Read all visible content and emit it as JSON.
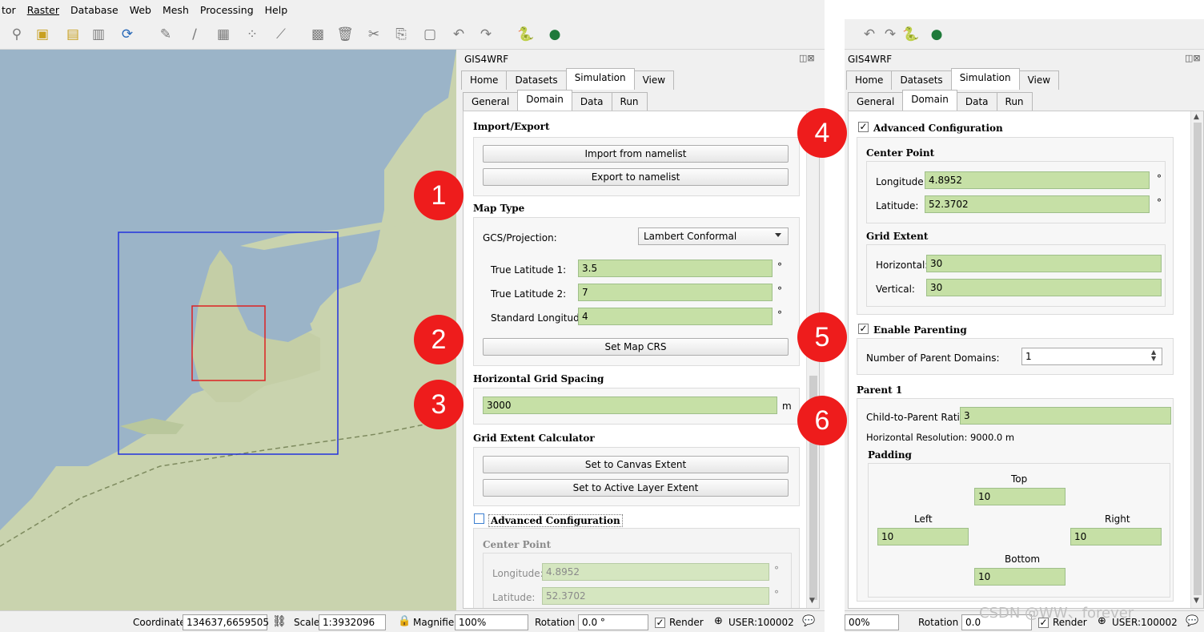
{
  "menu": [
    "tor",
    "Raster",
    "Database",
    "Web",
    "Mesh",
    "Processing",
    "Help"
  ],
  "panel_title": "GIS4WRF",
  "main_tabs": [
    "Home",
    "Datasets",
    "Simulation",
    "View"
  ],
  "sub_tabs": [
    "General",
    "Domain",
    "Data",
    "Run"
  ],
  "left_panel": {
    "import_export_title": "Import/Export",
    "import_button": "Import from namelist",
    "export_button": "Export to namelist",
    "map_type_title": "Map Type",
    "gcs_label": "GCS/Projection:",
    "gcs_value": "Lambert Conformal",
    "true_lat1_label": "True Latitude 1:",
    "true_lat1_value": "3.5",
    "true_lat2_label": "True Latitude 2:",
    "true_lat2_value": "7",
    "std_lon_label": "Standard Longitude:",
    "std_lon_value": "4",
    "degree": "°",
    "set_crs_button": "Set Map CRS",
    "grid_spacing_title": "Horizontal Grid Spacing",
    "grid_spacing_value": "3000",
    "grid_spacing_unit": "m",
    "grid_extent_calc_title": "Grid Extent Calculator",
    "canvas_extent_button": "Set to Canvas Extent",
    "active_layer_button": "Set to Active Layer Extent",
    "adv_config_label": "Advanced Configuration",
    "center_point_title": "Center Point",
    "longitude_label": "Longitude:",
    "longitude_value": "4.8952",
    "latitude_label": "Latitude:",
    "latitude_value": "52.3702"
  },
  "right_panel": {
    "adv_config_label": "Advanced Configuration",
    "center_point_title": "Center Point",
    "longitude_label": "Longitude:",
    "longitude_value": "4.8952",
    "latitude_label": "Latitude:",
    "latitude_value": "52.3702",
    "degree": "°",
    "grid_extent_title": "Grid Extent",
    "horizontal_label": "Horizontal:",
    "horizontal_value": "30",
    "vertical_label": "Vertical:",
    "vertical_value": "30",
    "enable_parenting_label": "Enable Parenting",
    "num_parent_label": "Number of Parent Domains:",
    "num_parent_value": "1",
    "parent_title": "Parent 1",
    "ratio_label": "Child-to-Parent Ratio:",
    "ratio_value": "3",
    "resolution_text": "Horizontal Resolution: 9000.0 m",
    "padding_title": "Padding",
    "top_label": "Top",
    "top_value": "10",
    "left_label": "Left",
    "left_value": "10",
    "right_label": "Right",
    "right_value": "10",
    "bottom_label": "Bottom",
    "bottom_value": "10"
  },
  "badges": [
    "1",
    "2",
    "3",
    "4",
    "5",
    "6"
  ],
  "status": {
    "coordinate_label": "Coordinate",
    "coordinate_value": "134637,6659505",
    "scale_label": "Scale",
    "scale_value": "1:3932096",
    "magnifier_label": "Magnifier",
    "magnifier_value": "100%",
    "rotation_label": "Rotation",
    "rotation_value": "0.0 °",
    "render_label": "Render",
    "crs_label": "USER:100002",
    "magnifier_value_2": "00%",
    "rotation_value_2": "0.0",
    "watermark": "CSDN @WW、forever"
  },
  "colors": {
    "badge": "#ee1c1c",
    "field_green": "#c6e0a6",
    "map_water": "#9bb4c8",
    "domain_outer": "#2233dd",
    "domain_inner": "#dd2222"
  }
}
